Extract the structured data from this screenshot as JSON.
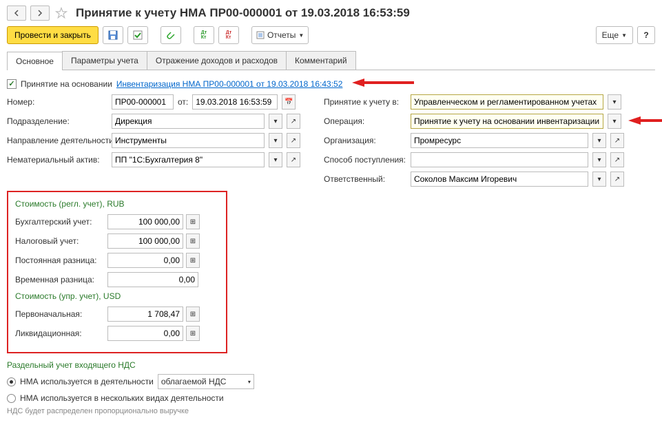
{
  "title": "Принятие к учету НМА ПР00-000001 от 19.03.2018 16:53:59",
  "toolbar": {
    "post_close": "Провести и закрыть",
    "reports": "Отчеты",
    "more": "Еще"
  },
  "tabs": {
    "main": "Основное",
    "params": "Параметры учета",
    "income": "Отражение доходов и расходов",
    "comment": "Комментарий"
  },
  "basis": {
    "label": "Принятие на основании",
    "link": "Инвентаризация НМА ПР00-000001 от 19.03.2018 16:43:52"
  },
  "fields": {
    "number_label": "Номер:",
    "number": "ПР00-000001",
    "from_label": "от:",
    "date": "19.03.2018 16:53:59",
    "accept_in_label": "Принятие к учету в:",
    "accept_in": "Управленческом и регламентированном учетах",
    "division_label": "Подразделение:",
    "division": "Дирекция",
    "operation_label": "Операция:",
    "operation": "Принятие к учету на основании инвентаризации",
    "activity_label": "Направление деятельности:",
    "activity": "Инструменты",
    "org_label": "Организация:",
    "org": "Промресурс",
    "asset_label": "Нематериальный актив:",
    "asset": "ПП \"1С:Бухгалтерия 8\"",
    "receipt_label": "Способ поступления:",
    "receipt": "",
    "responsible_label": "Ответственный:",
    "responsible": "Соколов Максим Игоревич"
  },
  "cost_reg": {
    "title": "Стоимость (регл. учет), RUB",
    "accounting_label": "Бухгалтерский учет:",
    "accounting": "100 000,00",
    "tax_label": "Налоговый учет:",
    "tax": "100 000,00",
    "perm_diff_label": "Постоянная разница:",
    "perm_diff": "0,00",
    "temp_diff_label": "Временная разница:",
    "temp_diff": "0,00"
  },
  "cost_mgmt": {
    "title": "Стоимость (упр. учет), USD",
    "initial_label": "Первоначальная:",
    "initial": "1 708,47",
    "liquidation_label": "Ликвидационная:",
    "liquidation": "0,00"
  },
  "vat": {
    "title": "Раздельный учет входящего НДС",
    "opt1": "НМА используется в деятельности",
    "opt1_value": "облагаемой НДС",
    "opt2": "НМА используется в нескольких видах деятельности",
    "note": "НДС будет распределен пропорционально выручке"
  }
}
